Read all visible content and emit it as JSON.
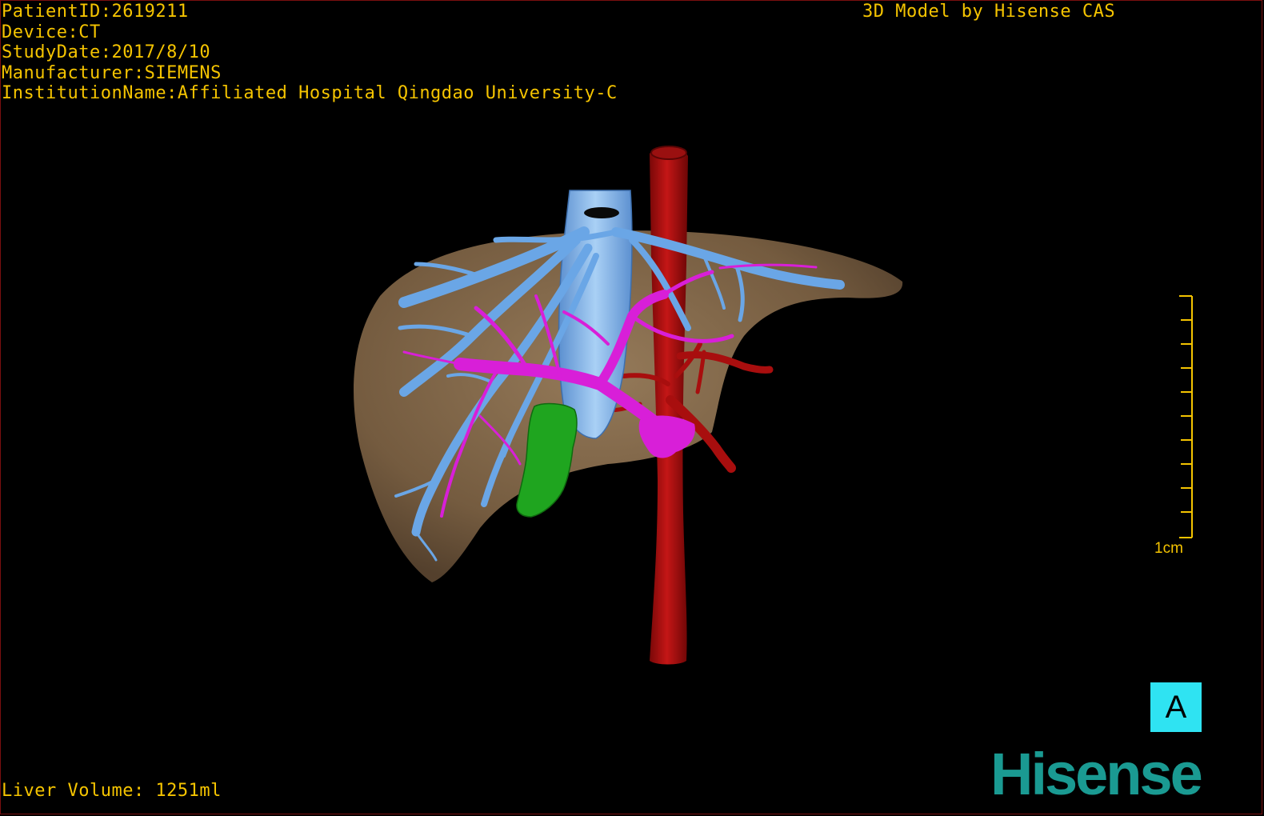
{
  "header": {
    "patient_id": "PatientID:2619211",
    "device": "Device:CT",
    "study_date": "StudyDate:2017/8/10",
    "manufacturer": "Manufacturer:SIEMENS",
    "institution": "InstitutionName:Affiliated Hospital Qingdao University-C"
  },
  "credit": "3D Model by Hisense CAS",
  "footer": {
    "liver_volume": "Liver Volume: 1251ml"
  },
  "scale_bar": {
    "label": "1cm"
  },
  "view_button": {
    "label": "A"
  },
  "logo": {
    "text": "Hisense"
  },
  "colors": {
    "text": "#f5c400",
    "liver": "#8f7350",
    "hepatic_vein": "#6aa6e6",
    "portal_vein": "#d81fd8",
    "artery": "#b01010",
    "tumor": "#1fa51f",
    "view_button_bg": "#2fe3f2",
    "logo": "#1a9a92"
  },
  "icons": {
    "model": "3d-liver-model",
    "scale": "scale-bar-icon"
  }
}
